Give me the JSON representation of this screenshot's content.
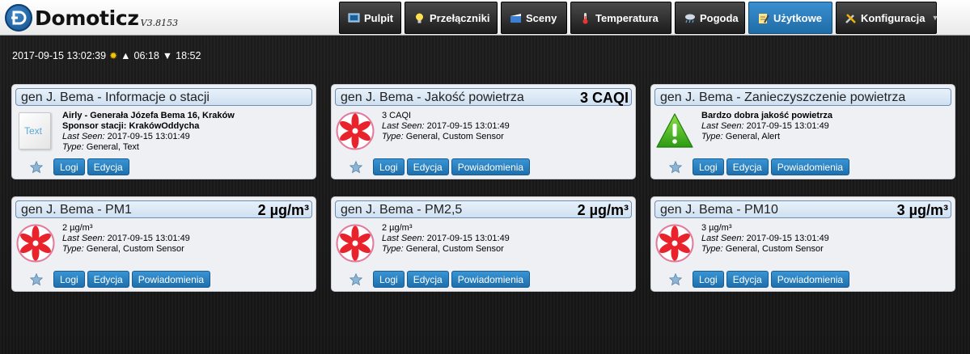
{
  "app": {
    "name": "Domoticz",
    "version": "V3.8153",
    "accent": "#2a7fc0"
  },
  "nav": [
    {
      "label": "Pulpit",
      "icon": "dashboard-icon"
    },
    {
      "label": "Przełączniki",
      "icon": "lightbulb-icon"
    },
    {
      "label": "Sceny",
      "icon": "scenes-icon"
    },
    {
      "label": "Temperatura",
      "icon": "thermometer-icon"
    },
    {
      "label": "Pogoda",
      "icon": "weather-icon"
    },
    {
      "label": "Użytkowe",
      "icon": "utility-icon",
      "active": true
    },
    {
      "label": "Konfiguracja",
      "icon": "tools-icon"
    }
  ],
  "status": {
    "datetime": "2017-09-15 13:02:39",
    "sunrise": "06:18",
    "sunset": "18:52"
  },
  "cards": [
    {
      "title": "gen J. Bema - Informacje o stacji",
      "value": "",
      "icon": "text-icon",
      "icon_text": "Text",
      "main_lines": [
        "Airly - Generała Józefa Bema 16, Kraków",
        "Sponsor stacji: KrakówOddycha"
      ],
      "last_seen_label": "Last Seen:",
      "last_seen": "2017-09-15 13:01:49",
      "type_label": "Type:",
      "type": "General, Text",
      "buttons": [
        "Logi",
        "Edycja"
      ]
    },
    {
      "title": "gen J. Bema - Jakość powietrza",
      "value": "3 CAQI",
      "icon": "fan-icon",
      "main_lines": [
        "3 CAQI"
      ],
      "last_seen_label": "Last Seen:",
      "last_seen": "2017-09-15 13:01:49",
      "type_label": "Type:",
      "type": "General, Custom Sensor",
      "buttons": [
        "Logi",
        "Edycja",
        "Powiadomienia"
      ]
    },
    {
      "title": "gen J. Bema - Zanieczyszczenie powietrza",
      "value": "",
      "icon": "alert-icon",
      "main_lines": [
        "Bardzo dobra jakość powietrza"
      ],
      "last_seen_label": "Last Seen:",
      "last_seen": "2017-09-15 13:01:49",
      "type_label": "Type:",
      "type": "General, Alert",
      "buttons": [
        "Logi",
        "Edycja",
        "Powiadomienia"
      ]
    },
    {
      "title": "gen J. Bema - PM1",
      "value": "2 µg/m³",
      "icon": "fan-icon",
      "main_lines": [
        "2 µg/m³"
      ],
      "last_seen_label": "Last Seen:",
      "last_seen": "2017-09-15 13:01:49",
      "type_label": "Type:",
      "type": "General, Custom Sensor",
      "buttons": [
        "Logi",
        "Edycja",
        "Powiadomienia"
      ]
    },
    {
      "title": "gen J. Bema - PM2,5",
      "value": "2 µg/m³",
      "icon": "fan-icon",
      "main_lines": [
        "2 µg/m³"
      ],
      "last_seen_label": "Last Seen:",
      "last_seen": "2017-09-15 13:01:49",
      "type_label": "Type:",
      "type": "General, Custom Sensor",
      "buttons": [
        "Logi",
        "Edycja",
        "Powiadomienia"
      ]
    },
    {
      "title": "gen J. Bema - PM10",
      "value": "3 µg/m³",
      "icon": "fan-icon",
      "main_lines": [
        "3 µg/m³"
      ],
      "last_seen_label": "Last Seen:",
      "last_seen": "2017-09-15 13:01:49",
      "type_label": "Type:",
      "type": "General, Custom Sensor",
      "buttons": [
        "Logi",
        "Edycja",
        "Powiadomienia"
      ]
    }
  ]
}
